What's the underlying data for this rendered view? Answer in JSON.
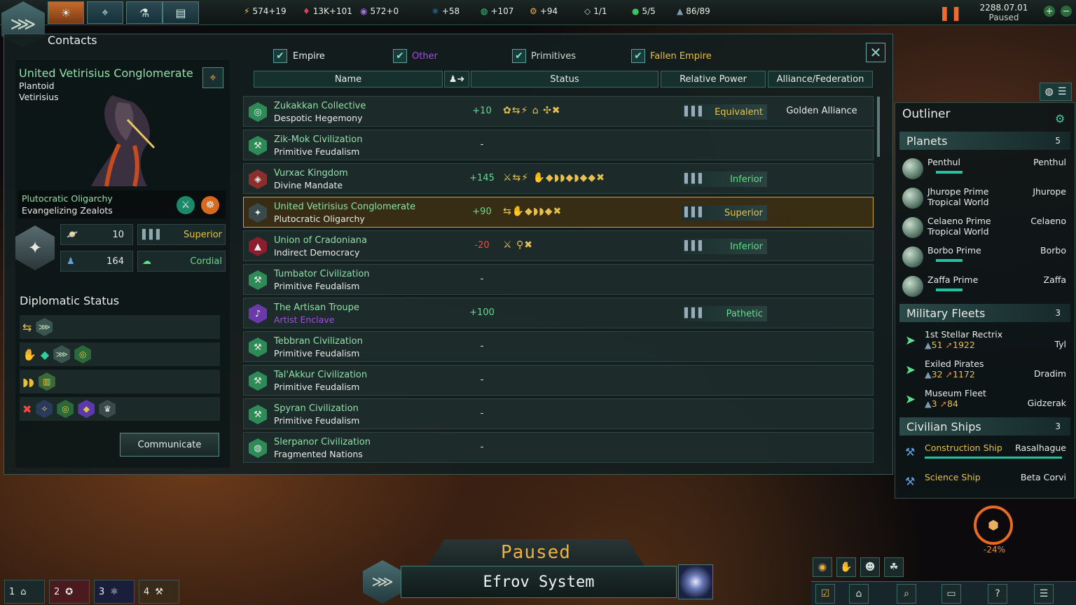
{
  "topbar": {
    "resources": [
      {
        "icon": "energy-icon",
        "glyph": "⚡",
        "value": "574+19",
        "color": "#f0c040"
      },
      {
        "icon": "minerals-icon",
        "glyph": "♦",
        "value": "13K+101",
        "color": "#e04060"
      },
      {
        "icon": "influence-icon",
        "glyph": "◉",
        "value": "572+0",
        "color": "#a070e0"
      },
      {
        "icon": "physics-icon",
        "glyph": "⚛",
        "value": "+58",
        "color": "#40a0e0"
      },
      {
        "icon": "society-icon",
        "glyph": "◍",
        "value": "+107",
        "color": "#40c080"
      },
      {
        "icon": "engineering-icon",
        "glyph": "⚙",
        "value": "+94",
        "color": "#f0b040"
      },
      {
        "icon": "edicts-icon",
        "glyph": "◇",
        "value": "1/1",
        "color": "#c0d0d0"
      },
      {
        "icon": "planets-icon",
        "glyph": "●",
        "value": "5/5",
        "color": "#40c060"
      },
      {
        "icon": "fleet-cap-icon",
        "glyph": "▲",
        "value": "86/89",
        "color": "#8098b0"
      }
    ],
    "date": "2288.07.01",
    "paused": "Paused"
  },
  "contacts": {
    "title": "Contacts",
    "filters": [
      {
        "label": "Empire",
        "checked": true,
        "color": "#e8ece8"
      },
      {
        "label": "Other",
        "checked": true,
        "color": "#a050e0"
      },
      {
        "label": "Primitives",
        "checked": true,
        "color": "#d0d8d0"
      },
      {
        "label": "Fallen Empire",
        "checked": true,
        "color": "#e8c040"
      }
    ],
    "columns": {
      "name": "Name",
      "status": "Status",
      "power": "Relative Power",
      "alliance": "Alliance/Federation"
    },
    "selected_empire": {
      "name": "United Vetirisius Conglomerate",
      "species": "Plantoid",
      "species_name": "Vetirisius",
      "government": "Plutocratic Oligarchy",
      "ethic": "Evangelizing Zealots",
      "systems": "10",
      "pops": "164",
      "relative_power": "Superior",
      "opinion": "Cordial",
      "diplomatic_status_title": "Diplomatic Status",
      "communicate_label": "Communicate"
    },
    "rows": [
      {
        "name": "Zukakkan Collective",
        "gov": "Despotic Hegemony",
        "opinion": "+10",
        "op_color": "#5ee08a",
        "status": "✿⇆⚡ ⌂ ✣✖",
        "power": "Equivalent",
        "power_color": "#e8c040",
        "alliance": "Golden Alliance",
        "icon_color": "#2e8a56",
        "icon_glyph": "◎",
        "gov_color": "#e8ece8"
      },
      {
        "name": "Zik-Mok Civilization",
        "gov": "Primitive Feudalism",
        "opinion": "-",
        "op_color": "#e8ece8",
        "status": "",
        "power": "",
        "power_color": "",
        "alliance": "",
        "icon_color": "#2e8a56",
        "icon_glyph": "⚒",
        "gov_color": "#e8ece8"
      },
      {
        "name": "Vurxac Kingdom",
        "gov": "Divine Mandate",
        "opinion": "+145",
        "op_color": "#5ee08a",
        "status": "⚔⇆⚡ ✋◆◗◗◆◗◆◆✖",
        "power": "Inferior",
        "power_color": "#5ee08a",
        "alliance": "",
        "icon_color": "#8a2e2e",
        "icon_glyph": "◈",
        "gov_color": "#e8ece8"
      },
      {
        "name": "United Vetirisius Conglomerate",
        "gov": "Plutocratic Oligarchy",
        "opinion": "+90",
        "op_color": "#5ee08a",
        "status": "⇆✋◆◗◗◆✖",
        "power": "Superior",
        "power_color": "#e8c040",
        "alliance": "",
        "icon_color": "#3a4a4a",
        "icon_glyph": "✦",
        "gov_color": "#e8ece8",
        "selected": true
      },
      {
        "name": "Union of Cradoniana",
        "gov": "Indirect Democracy",
        "opinion": "-20",
        "op_color": "#f04a40",
        "status": "⚔ ⚲✖",
        "power": "Inferior",
        "power_color": "#5ee08a",
        "alliance": "",
        "icon_color": "#8a1e2e",
        "icon_glyph": "▲",
        "gov_color": "#e8ece8"
      },
      {
        "name": "Tumbator Civilization",
        "gov": "Primitive Feudalism",
        "opinion": "-",
        "op_color": "#e8ece8",
        "status": "",
        "power": "",
        "power_color": "",
        "alliance": "",
        "icon_color": "#2e8a56",
        "icon_glyph": "⚒",
        "gov_color": "#e8ece8"
      },
      {
        "name": "The Artisan Troupe",
        "gov": "Artist Enclave",
        "opinion": "+100",
        "op_color": "#5ee08a",
        "status": "",
        "power": "Pathetic",
        "power_color": "#5ee08a",
        "alliance": "",
        "icon_color": "#6a3aa8",
        "icon_glyph": "♪",
        "gov_color": "#a050e0"
      },
      {
        "name": "Tebbran Civilization",
        "gov": "Primitive Feudalism",
        "opinion": "-",
        "op_color": "#e8ece8",
        "status": "",
        "power": "",
        "power_color": "",
        "alliance": "",
        "icon_color": "#2e8a56",
        "icon_glyph": "⚒",
        "gov_color": "#e8ece8"
      },
      {
        "name": "Tal'Akkur Civilization",
        "gov": "Primitive Feudalism",
        "opinion": "-",
        "op_color": "#e8ece8",
        "status": "",
        "power": "",
        "power_color": "",
        "alliance": "",
        "icon_color": "#2e8a56",
        "icon_glyph": "⚒",
        "gov_color": "#e8ece8"
      },
      {
        "name": "Spyran Civilization",
        "gov": "Primitive Feudalism",
        "opinion": "-",
        "op_color": "#e8ece8",
        "status": "",
        "power": "",
        "power_color": "",
        "alliance": "",
        "icon_color": "#2e8a56",
        "icon_glyph": "⚒",
        "gov_color": "#e8ece8"
      },
      {
        "name": "Slerpanor Civilization",
        "gov": "Fragmented Nations",
        "opinion": "-",
        "op_color": "#e8ece8",
        "status": "",
        "power": "",
        "power_color": "",
        "alliance": "",
        "icon_color": "#2e8a56",
        "icon_glyph": "◍",
        "gov_color": "#e8ece8"
      }
    ]
  },
  "outliner": {
    "title": "Outliner",
    "planets_title": "Planets",
    "planets_count": "5",
    "planets": [
      {
        "name": "Penthul",
        "sub": "",
        "system": "Penthul"
      },
      {
        "name": "Jhurope Prime",
        "sub": "Tropical World",
        "system": "Jhurope"
      },
      {
        "name": "Celaeno Prime",
        "sub": "Tropical World",
        "system": "Celaeno"
      },
      {
        "name": "Borbo Prime",
        "sub": "",
        "system": "Borbo"
      },
      {
        "name": "Zaffa Prime",
        "sub": "",
        "system": "Zaffa"
      }
    ],
    "fleets_title": "Military Fleets",
    "fleets_count": "3",
    "fleets": [
      {
        "name": "1st Stellar Rectrix",
        "ships": "51",
        "power": "1922",
        "location": "Tyl"
      },
      {
        "name": "Exiled Pirates",
        "ships": "32",
        "power": "1172",
        "location": "Dradim"
      },
      {
        "name": "Museum Fleet",
        "ships": "3",
        "power": "84",
        "location": "Gidzerak"
      }
    ],
    "civilian_title": "Civilian Ships",
    "civilian_count": "3",
    "civilian": [
      {
        "name": "Construction Ship",
        "location": "Rasalhague"
      },
      {
        "name": "Science Ship",
        "location": "Beta Corvi"
      }
    ]
  },
  "bottom": {
    "paused": "Paused",
    "system": "Efrov System",
    "tabs": [
      "1",
      "2",
      "3",
      "4"
    ],
    "growth": "-24%"
  }
}
